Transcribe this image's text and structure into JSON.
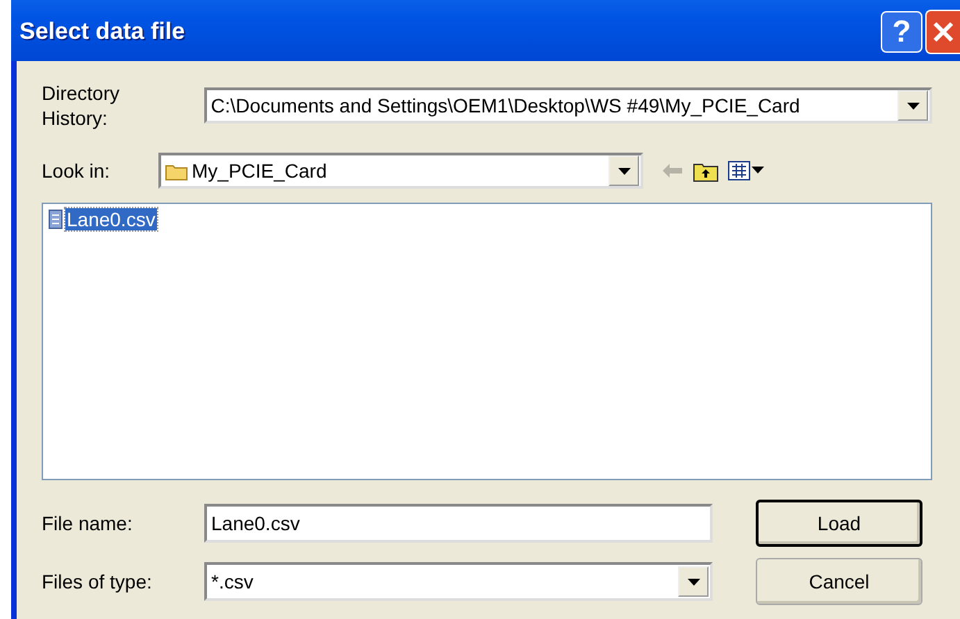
{
  "window": {
    "title": "Select data file",
    "help_button": "?"
  },
  "directory_history": {
    "label_lines": [
      "Directory",
      "History:"
    ],
    "value": "C:\\Documents and Settings\\OEM1\\Desktop\\WS #49\\My_PCIE_Card"
  },
  "look_in": {
    "label": "Look in:",
    "value": "My_PCIE_Card"
  },
  "files": [
    {
      "name": "Lane0.csv",
      "selected": true
    }
  ],
  "file_name": {
    "label": "File name:",
    "value": "Lane0.csv"
  },
  "files_of_type": {
    "label": "Files of type:",
    "value": "*.csv"
  },
  "buttons": [
    {
      "label": "Load",
      "default": true
    },
    {
      "label": "Cancel",
      "default": false
    }
  ]
}
